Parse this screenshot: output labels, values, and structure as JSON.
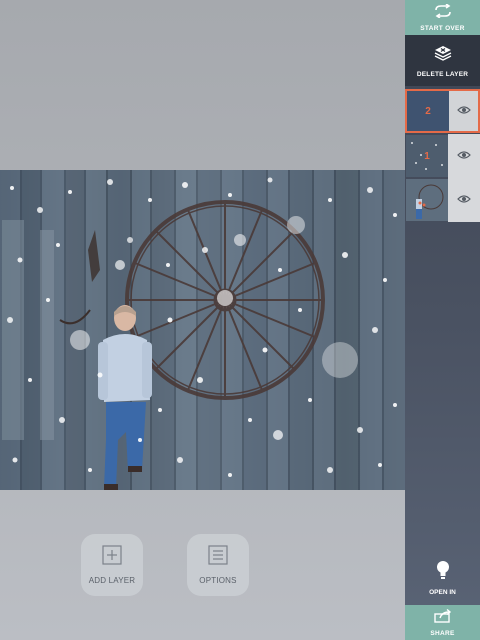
{
  "sidebar": {
    "start_over_label": "START OVER",
    "delete_layer_label": "DELETE LAYER",
    "layers": [
      {
        "number": "2",
        "selected": true,
        "visible": true
      },
      {
        "number": "1",
        "selected": false,
        "visible": true
      },
      {
        "number": "",
        "selected": false,
        "visible": true
      }
    ],
    "open_in_label": "OPEN IN",
    "share_label": "SHARE"
  },
  "toolbar": {
    "add_layer_label": "ADD LAYER",
    "options_label": "OPTIONS"
  },
  "colors": {
    "accent": "#7fb3a8",
    "selection": "#e46a48",
    "sidebar_dark": "#2f3540"
  },
  "icons": {
    "start_over": "refresh-arrows-icon",
    "delete_layer": "layers-x-icon",
    "visibility": "eye-icon",
    "open_in": "lightbulb-icon",
    "share": "share-arrow-icon",
    "add_layer": "plus-square-icon",
    "options": "list-lines-icon"
  }
}
